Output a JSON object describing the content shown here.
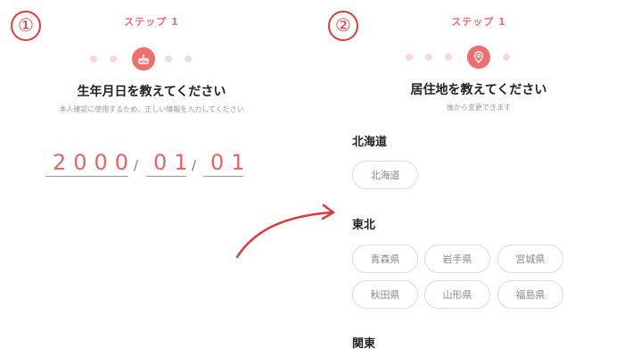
{
  "markers": {
    "left": "①",
    "right": "②"
  },
  "step1": {
    "step_label": "ステップ 1",
    "progress_icon": "cake-icon",
    "title": "生年月日を教えてください",
    "subtitle": "本人確認に使用するため、正しい情報を入力してください",
    "date": {
      "year": "2000",
      "month": "01",
      "day": "01",
      "separator": "/"
    }
  },
  "step2": {
    "step_label": "ステップ 1",
    "progress_icon": "location-pin-icon",
    "title": "居住地を教えてください",
    "subtitle": "後から変更できます",
    "regions": [
      {
        "name": "北海道",
        "prefectures": [
          "北海道"
        ]
      },
      {
        "name": "東北",
        "prefectures": [
          "青森県",
          "岩手県",
          "宮城県",
          "秋田県",
          "山形県",
          "福島県"
        ]
      },
      {
        "name": "関東",
        "prefectures": []
      }
    ]
  },
  "colors": {
    "accent": "#ef6f6f",
    "accent_text": "#e56565",
    "marker_red": "#e03a3a",
    "progress_dot": "#f7d9d9",
    "chip_border": "#dcdcdc",
    "muted_text": "#999999"
  },
  "arrow_icon": "curved-arrow-icon"
}
